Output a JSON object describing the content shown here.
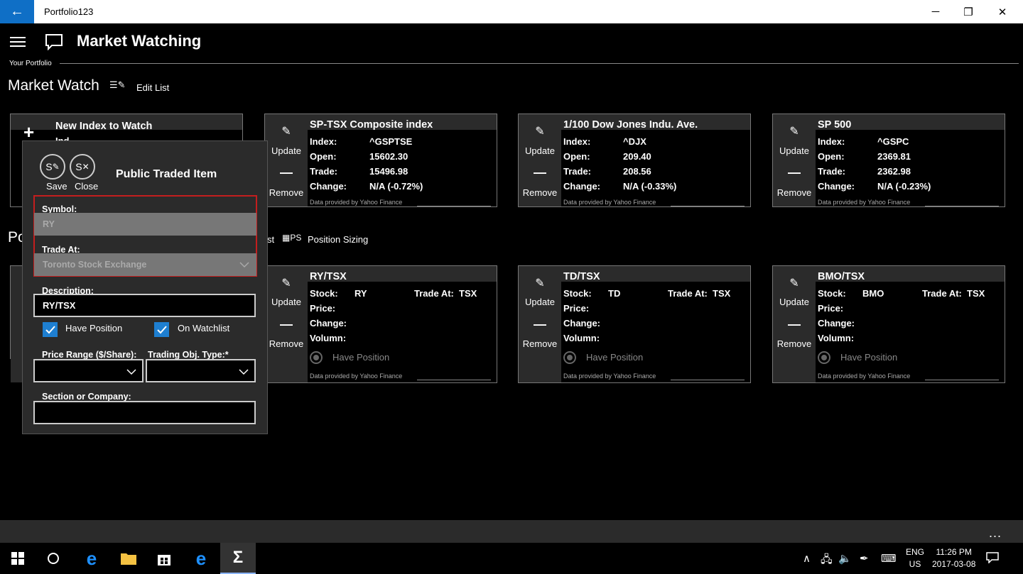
{
  "window": {
    "app_title": "Portfolio123",
    "back_icon": "arrow-left-icon",
    "minimize": "─",
    "maximize": "❐",
    "close": "✕"
  },
  "header": {
    "menu_icon": "hamburger-icon",
    "page_title": "Market Watching",
    "your_portfolio": "Your Portfolio",
    "section_title": "Market Watch",
    "edit_list_label": "Edit List"
  },
  "tiles_labels": {
    "update": "Update",
    "remove": "Remove",
    "footer": "Data provided by Yahoo Finance"
  },
  "new_index_tile": {
    "plus": "+",
    "title": "New Index to Watch",
    "sub": "Ind"
  },
  "index_tiles": [
    {
      "title": "SP-TSX Composite index",
      "index_label": "Index:",
      "index": "^GSPTSE",
      "open_label": "Open:",
      "open": "15602.30",
      "trade_label": "Trade:",
      "trade": "15496.98",
      "change_label": "Change:",
      "change": "N/A (-0.72%)"
    },
    {
      "title": "1/100 Dow Jones Indu. Ave.",
      "index_label": "Index:",
      "index": "^DJX",
      "open_label": "Open:",
      "open": "209.40",
      "trade_label": "Trade:",
      "trade": "208.56",
      "change_label": "Change:",
      "change": "N/A (-0.33%)"
    },
    {
      "title": "SP 500",
      "index_label": "Index:",
      "index": "^GSPC",
      "open_label": "Open:",
      "open": "2369.81",
      "trade_label": "Trade:",
      "trade": "2362.98",
      "change_label": "Change:",
      "change": "N/A (-0.23%)"
    }
  ],
  "section2": {
    "partial_title": "Po",
    "partial_list": "st",
    "ps_icon": "PS",
    "position_sizing": "Position Sizing"
  },
  "stock_tiles": [
    {
      "title": "RY/TSX",
      "stock_label": "Stock:",
      "stock": "RY",
      "trade_at_label": "Trade At:",
      "trade_at": "TSX",
      "price_label": "Price:",
      "change_label": "Change:",
      "volume_label": "Volumn:",
      "have_position": "Have Position"
    },
    {
      "title": "TD/TSX",
      "stock_label": "Stock:",
      "stock": "TD",
      "trade_at_label": "Trade At:",
      "trade_at": "TSX",
      "price_label": "Price:",
      "change_label": "Change:",
      "volume_label": "Volumn:",
      "have_position": "Have Position"
    },
    {
      "title": "BMO/TSX",
      "stock_label": "Stock:",
      "stock": "BMO",
      "trade_at_label": "Trade At:",
      "trade_at": "TSX",
      "price_label": "Price:",
      "change_label": "Change:",
      "volume_label": "Volumn:",
      "have_position": "Have Position"
    }
  ],
  "popup": {
    "save_icon_text": "S",
    "save_label": "Save",
    "close_icon_text": "S",
    "close_label": "Close",
    "title": "Public Traded Item",
    "symbol_label": "Symbol:",
    "symbol_value": "RY",
    "trade_at_label": "Trade At:",
    "trade_at_value": "Toronto Stock Exchange",
    "description_label": "Description:",
    "description_value": "RY/TSX",
    "have_position_label": "Have Position",
    "have_position_checked": true,
    "on_watchlist_label": "On Watchlist",
    "on_watchlist_checked": true,
    "price_range_label": "Price Range ($/Share):",
    "price_range_value": "",
    "trading_obj_label": "Trading Obj. Type:*",
    "trading_obj_value": "",
    "section_label": "Section or Company:",
    "section_value": ""
  },
  "appbar": {
    "more": "..."
  },
  "taskbar": {
    "lang": "ENG",
    "region": "US",
    "time": "11:26 PM",
    "date": "2017-03-08"
  },
  "colors": {
    "accent": "#0f6fc6",
    "checkbox": "#1e7fd1",
    "error_border": "#c41e1e",
    "panel": "#2b2b2b"
  }
}
